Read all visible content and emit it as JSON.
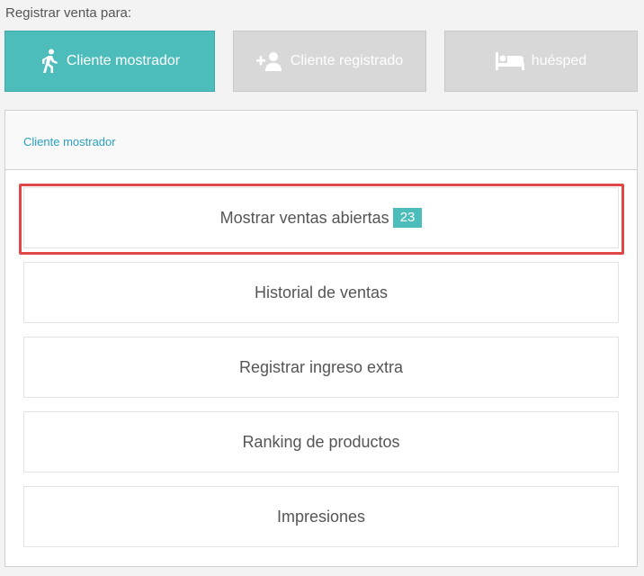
{
  "header": {
    "title": "Registrar venta para:"
  },
  "customer_types": [
    {
      "label": "Cliente mostrador",
      "icon": "walking-person-icon"
    },
    {
      "label": "Cliente registrado",
      "icon": "add-user-icon"
    },
    {
      "label": "huésped",
      "icon": "bed-icon"
    }
  ],
  "panel": {
    "selected_label": "Cliente mostrador",
    "actions": [
      {
        "label": "Mostrar ventas abiertas",
        "badge": "23"
      },
      {
        "label": "Historial de ventas"
      },
      {
        "label": "Registrar ingreso extra"
      },
      {
        "label": "Ranking de productos"
      },
      {
        "label": "Impresiones"
      }
    ]
  },
  "colors": {
    "accent": "#4dbdbb",
    "inactive": "#d8d8d8",
    "link": "#2a9fc0",
    "highlight": "#e04848"
  }
}
